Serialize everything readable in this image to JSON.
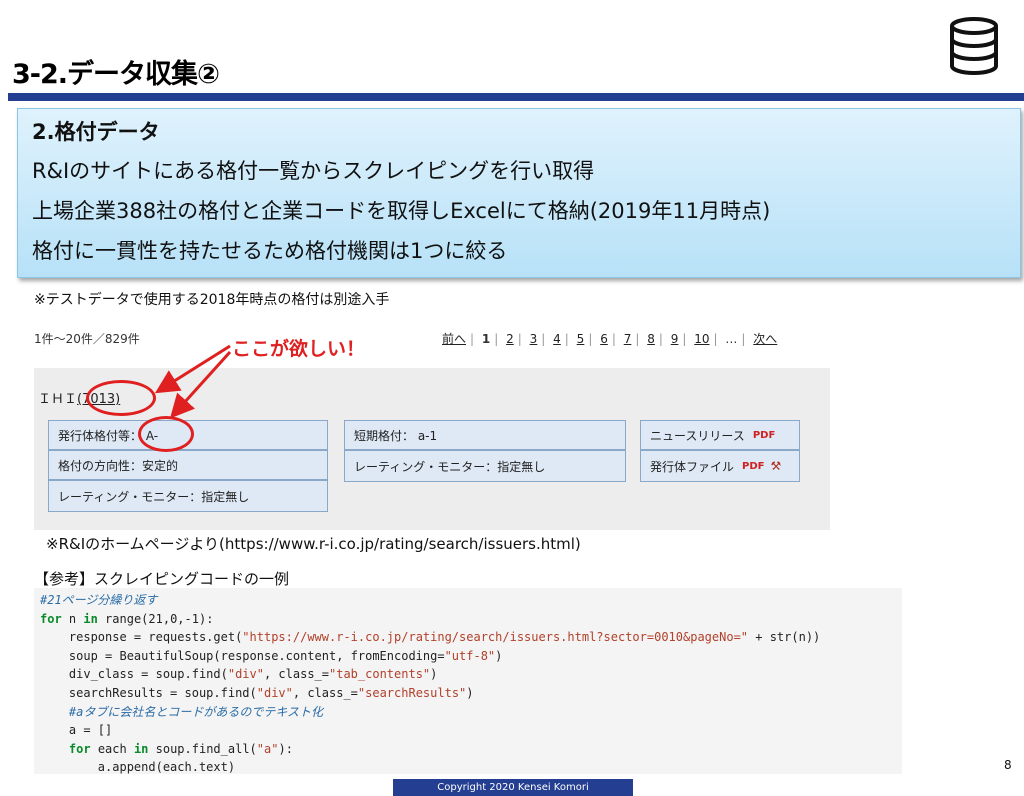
{
  "slide": {
    "title": "3-2.データ収集②",
    "icon": "database-icon"
  },
  "info_box": {
    "heading": "2.格付データ",
    "lines": [
      "R&Iのサイトにある格付一覧からスクレイピングを行い取得",
      "上場企業388社の格付と企業コードを取得しExcelにて格納(2019年11月時点)",
      "格付に一貫性を持たせるため格付機関は1つに絞る"
    ]
  },
  "notes": {
    "test_data": "※テストデータで使用する2018年時点の格付は別途入手",
    "source": "※R&Iのホームページより(https://www.r-i.co.jp/rating/search/issuers.html)",
    "code_caption": "【参考】スクレイピングコードの一例"
  },
  "screenshot": {
    "result_count": "1件～20件／829件",
    "pager": {
      "prev": "前へ",
      "pages": [
        "1",
        "2",
        "3",
        "4",
        "5",
        "6",
        "7",
        "8",
        "9",
        "10"
      ],
      "current": "1",
      "ellipsis": "…",
      "next": "次へ"
    },
    "callout": "ここが欲しい！",
    "company_name": "ＩＨＩ",
    "company_code": "(7013)",
    "cells": {
      "issuer_rating": "発行体格付等： A-",
      "rating_direction": "格付の方向性：安定的",
      "rating_monitor_left": "レーティング・モニター：指定無し",
      "short_term_rating": "短期格付： a-1",
      "rating_monitor_right": "レーティング・モニター：指定無し",
      "news_release": "ニュースリリース",
      "issuer_file": "発行体ファイル",
      "pdf_label": "PDF"
    }
  },
  "code": {
    "line1": "#21ページ分繰り返す",
    "line2_kw": "for",
    "line2_a": " n ",
    "line2_kw2": "in",
    "line2_b": " range(21,0,-1):",
    "line3_a": "    response = requests.get(",
    "line3_s": "\"https://www.r-i.co.jp/rating/search/issuers.html?sector=0010&pageNo=\"",
    "line3_b": " + str(n))",
    "line4_a": "    soup = BeautifulSoup(response.content, fromEncoding=",
    "line4_s": "\"utf-8\"",
    "line4_b": ")",
    "line5_a": "    div_class = soup.find(",
    "line5_s1": "\"div\"",
    "line5_b": ", class_=",
    "line5_s2": "\"tab_contents\"",
    "line5_c": ")",
    "line6_a": "    searchResults = soup.find(",
    "line6_s1": "\"div\"",
    "line6_b": ", class_=",
    "line6_s2": "\"searchResults\"",
    "line6_c": ")",
    "line7": "    #aタブに会社名とコードがあるのでテキスト化",
    "line8": "    a = []",
    "line9_a": "    ",
    "line9_kw": "for",
    "line9_b": " each ",
    "line9_kw2": "in",
    "line9_c": " soup.find_all(",
    "line9_s": "\"a\"",
    "line9_d": "):",
    "line10": "        a.append(each.text)"
  },
  "footer": {
    "copyright": "Copyright  2020  Kensei Komori",
    "page_number": "8"
  },
  "colors": {
    "accent": "#243e91",
    "callout": "#e02020"
  }
}
